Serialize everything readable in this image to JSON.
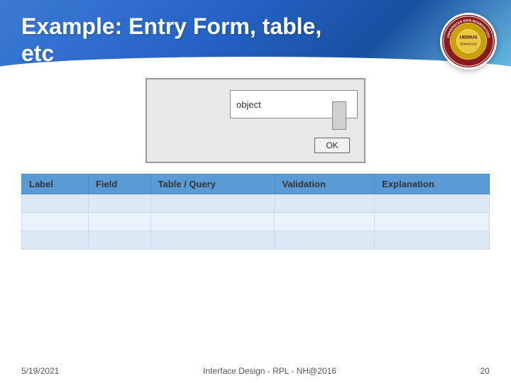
{
  "header": {
    "title_line1": "Example: Entry Form, table,",
    "title_line2": "etc",
    "logo_outer_text": "UNIVERSITAS\nDIAN\nNUSWANTORO",
    "logo_inner_text": "UDINUS",
    "logo_subtext": "SEMARANG"
  },
  "dialog": {
    "input_placeholder": "object",
    "ok_label": "OK"
  },
  "table": {
    "headers": [
      "Label",
      "Field",
      "Table / Query",
      "Validation",
      "Explanation"
    ],
    "rows": [
      [
        "",
        "",
        "",
        "",
        ""
      ],
      [
        "",
        "",
        "",
        "",
        ""
      ],
      [
        "",
        "",
        "",
        "",
        ""
      ]
    ]
  },
  "footer": {
    "date": "5/19/2021",
    "center_text": "Interface Design - RPL - NH@2016",
    "page_number": "20"
  }
}
